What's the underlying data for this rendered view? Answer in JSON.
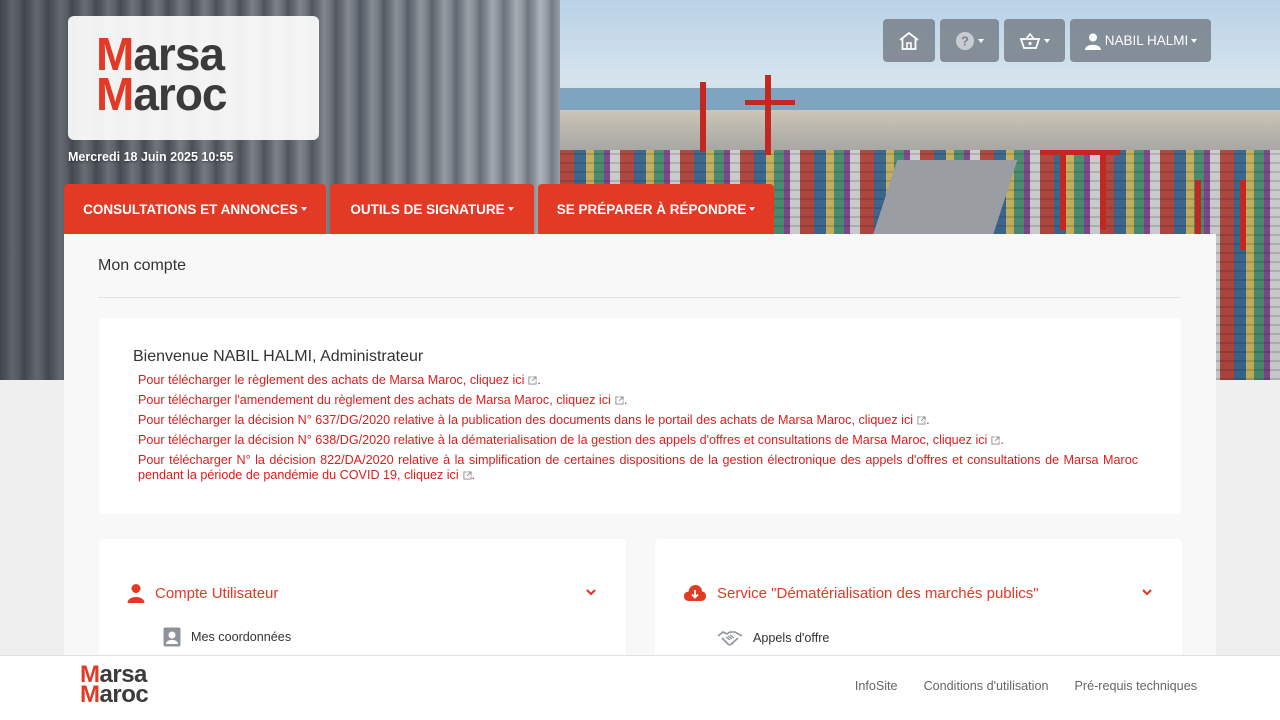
{
  "header": {
    "logo_line1": "Marsa",
    "logo_line2": "Maroc",
    "date": "Mercredi 18 Juin 2025 10:55",
    "home_icon": "home-icon",
    "help_icon": "help-circle-icon",
    "cart_icon": "basket-icon",
    "user_icon": "user-icon",
    "user_name": "NABIL HALMI"
  },
  "nav": {
    "tabs": [
      {
        "label": "CONSULTATIONS ET ANNONCES"
      },
      {
        "label": "OUTILS DE SIGNATURE"
      },
      {
        "label": "SE PRÉPARER À RÉPONDRE"
      }
    ]
  },
  "main": {
    "title": "Mon compte",
    "welcome": "Bienvenue NABIL HALMI, Administrateur",
    "links": [
      {
        "text": "Pour télécharger le règlement des achats de Marsa Maroc,",
        "link": "cliquez ici"
      },
      {
        "text": "Pour télécharger l'amendement du règlement des achats de Marsa Maroc,",
        "link": "cliquez ici"
      },
      {
        "text": "Pour télécharger la décision N° 637/DG/2020 relative à la publication des documents dans le portail des achats de Marsa Maroc,",
        "link": "cliquez ici"
      },
      {
        "text": "Pour télécharger la décision N° 638/DG/2020 relative à la dématerialisation de la gestion des appels d'offres et consultations de Marsa Maroc,",
        "link": "cliquez ici"
      },
      {
        "text": "Pour télécharger N° la décision 822/DA/2020 relative à la simplification de certaines dispositions de la gestion électronique des appels d'offres et consultations de Marsa Maroc pendant la période de pandémie du COVID 19,",
        "link": "cliquez ici"
      }
    ],
    "cards": [
      {
        "title": "Compte Utilisateur",
        "icon": "user-icon",
        "item": "Mes coordonnées",
        "item_icon": "id-card-icon"
      },
      {
        "title": "Service \"Dématérialisation des marchés publics\"",
        "icon": "cloud-download-icon",
        "item": "Appels d'offre",
        "item_icon": "handshake-icon"
      }
    ]
  },
  "footer": {
    "logo_line1": "Marsa",
    "logo_line2": "Maroc",
    "links": [
      "InfoSite",
      "Conditions d'utilisation",
      "Pré-requis techniques"
    ]
  },
  "colors": {
    "accent": "#e23a25",
    "link_red": "#e01b1b",
    "panel_bg": "#f8f8f9",
    "page_bg": "#efefef"
  }
}
